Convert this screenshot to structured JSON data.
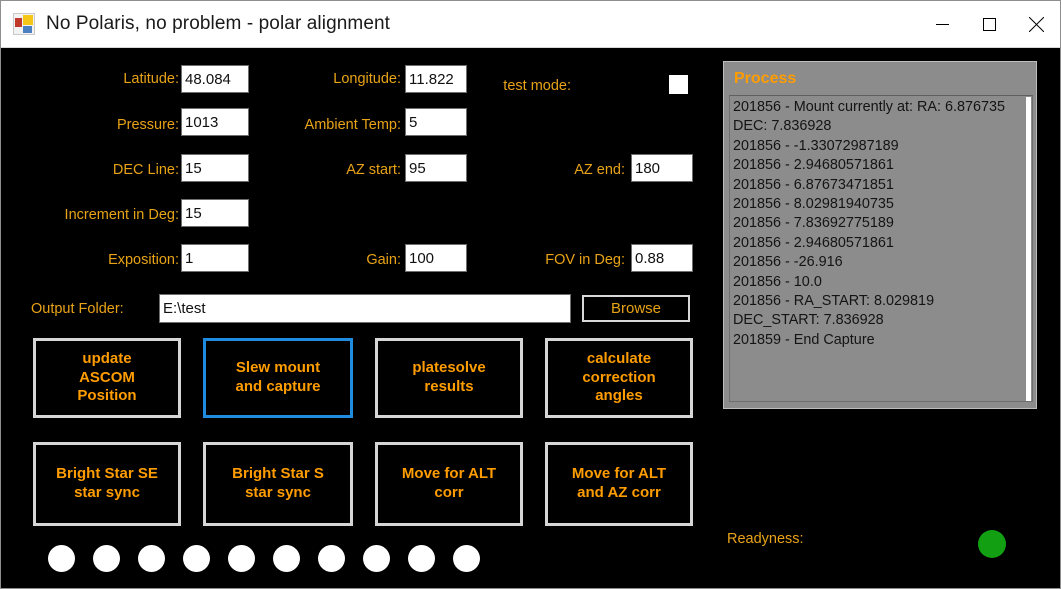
{
  "window": {
    "title": "No Polaris, no problem - polar alignment",
    "icon": "app-grid-icon",
    "controls": {
      "minimize": "minimize-icon",
      "maximize": "maximize-icon",
      "close": "close-icon"
    }
  },
  "colors": {
    "label_orange": "#e8a317",
    "button_orange": "#ff9d00",
    "background": "#000000",
    "focus_blue": "#1f8ce0",
    "panel_gray": "#8c8c8c",
    "ready_green": "#12a012"
  },
  "form": {
    "fields": [
      {
        "label": "Latitude:",
        "value": "48.084"
      },
      {
        "label": "Longitude:",
        "value": "11.822"
      },
      {
        "label": "Pressure:",
        "value": "1013"
      },
      {
        "label": "Ambient Temp:",
        "value": "5"
      },
      {
        "label": "DEC Line:",
        "value": "15"
      },
      {
        "label": "AZ start:",
        "value": "95"
      },
      {
        "label": "AZ end:",
        "value": "180"
      },
      {
        "label": "Increment in Deg:",
        "value": "15"
      },
      {
        "label": "Exposition:",
        "value": "1"
      },
      {
        "label": "Gain:",
        "value": "100"
      },
      {
        "label": "FOV in Deg:",
        "value": "0.88"
      }
    ],
    "test_mode": {
      "label": "test mode:",
      "checked": false
    },
    "output_folder": {
      "label": "Output Folder:",
      "value": "E:\\test",
      "browse_label": "Browse"
    }
  },
  "actions": {
    "row1": [
      {
        "label": "update\nASCOM\nPosition",
        "focused": false
      },
      {
        "label": "Slew mount\nand capture",
        "focused": true
      },
      {
        "label": "platesolve\nresults",
        "focused": false
      },
      {
        "label": "calculate\ncorrection\nangles",
        "focused": false
      }
    ],
    "row2": [
      {
        "label": "Bright Star SE\nstar sync",
        "focused": false
      },
      {
        "label": "Bright Star S\nstar sync",
        "focused": false
      },
      {
        "label": "Move for ALT\ncorr",
        "focused": false
      },
      {
        "label": "Move for ALT\nand AZ corr",
        "focused": false
      }
    ]
  },
  "status": {
    "dots": [
      "white",
      "white",
      "white",
      "white",
      "white",
      "white",
      "white",
      "white",
      "white",
      "white"
    ],
    "readyness": {
      "label": "Readyness:",
      "state": "green"
    }
  },
  "process": {
    "title": "Process",
    "log": [
      "201856 - Mount currently at: RA: 6.876735",
      "DEC: 7.836928",
      "201856 - -1.33072987189",
      "201856 - 2.94680571861",
      "201856 - 6.87673471851",
      "201856 - 8.02981940735",
      "201856 - 7.83692775189",
      "201856 - 2.94680571861",
      "201856 - -26.916",
      "201856 - 10.0",
      "201856 - RA_START: 8.029819",
      "DEC_START: 7.836928",
      "201859 - End Capture"
    ]
  }
}
